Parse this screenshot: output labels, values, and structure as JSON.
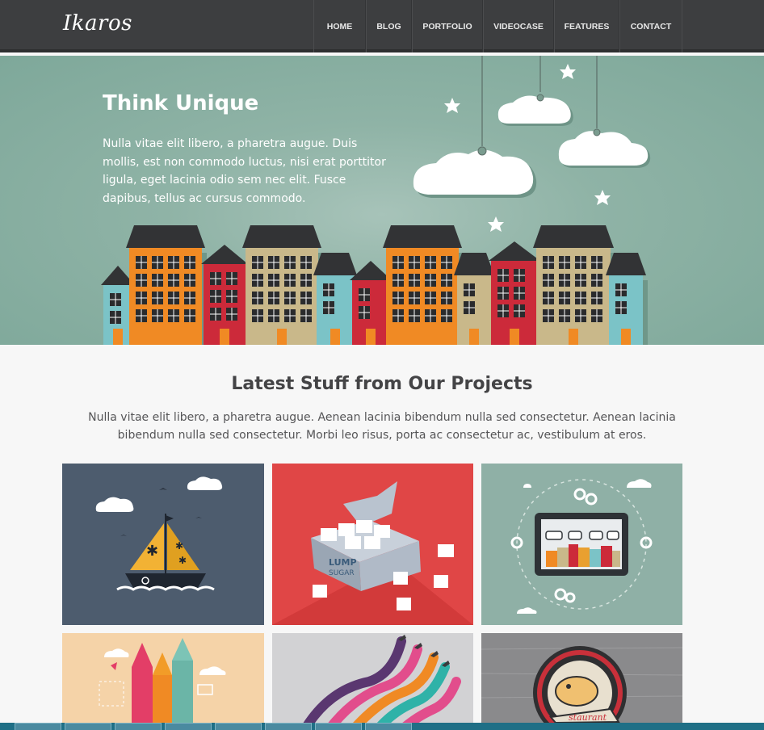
{
  "nav": {
    "logo": "Ikaros",
    "items": [
      "HOME",
      "BLOG",
      "PORTFOLIO",
      "VIDEOCASE",
      "FEATURES",
      "CONTACT"
    ]
  },
  "hero": {
    "title": "Think Unique",
    "text": "Nulla vitae elit libero, a pharetra augue. Duis mollis, est non commodo luctus, nisi erat porttitor ligula, eget lacinia odio sem nec elit. Fusce dapibus, tellus ac cursus commodo."
  },
  "projects": {
    "title": "Latest Stuff from Our Projects",
    "text": "Nulla vitae elit libero, a pharetra augue. Aenean lacinia bibendum nulla sed consectetur. Aenean lacinia bibendum nulla sed consectetur. Morbi leo risus, porta ac consectetur ac, vestibulum at eros.",
    "tiles": [
      {
        "subject": "sailboat",
        "bg": "#4d5c6e"
      },
      {
        "subject": "lump-sugar",
        "bg": "#e04646",
        "box_text_1": "LUMP",
        "box_text_2": "SUGAR"
      },
      {
        "subject": "tablet-town",
        "bg": "#8fb0a6"
      },
      {
        "subject": "pencils",
        "bg": "#f5d3a8"
      },
      {
        "subject": "airplanes",
        "bg": "#d2d2d4"
      },
      {
        "subject": "fish-badge",
        "bg": "#8a8a8c",
        "ribbon_text": "staurant"
      }
    ]
  },
  "colors": {
    "nav": "#3d3e40",
    "hero": "#8fb3a6",
    "taskbar": "#1f6f86"
  }
}
